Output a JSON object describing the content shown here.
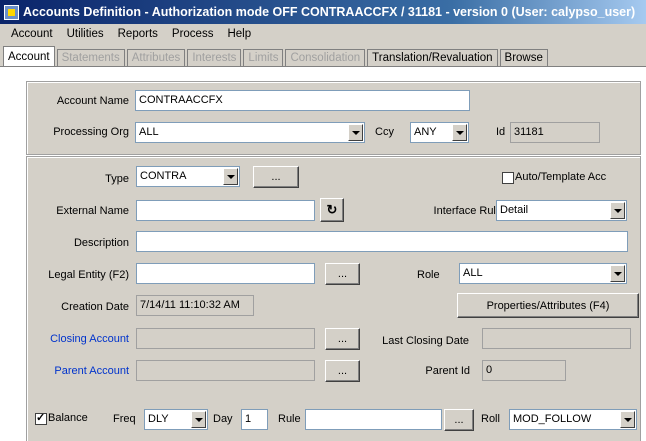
{
  "window": {
    "title": "Accounts Definition - Authorization mode OFF CONTRAACCFX / 31181 - version 0 (User: calypso_user)"
  },
  "menu": [
    "Account",
    "Utilities",
    "Reports",
    "Process",
    "Help"
  ],
  "tabs": [
    {
      "label": "Account",
      "state": "active"
    },
    {
      "label": "Statements",
      "state": "disabled"
    },
    {
      "label": "Attributes",
      "state": "disabled"
    },
    {
      "label": "Interests",
      "state": "disabled"
    },
    {
      "label": "Limits",
      "state": "disabled"
    },
    {
      "label": "Consolidation",
      "state": "disabled"
    },
    {
      "label": "Translation/Revaluation",
      "state": "enabled"
    },
    {
      "label": "Browse",
      "state": "enabled"
    }
  ],
  "header": {
    "account_name_label": "Account Name",
    "account_name_value": "CONTRAACCFX",
    "processing_org_label": "Processing Org",
    "processing_org_value": "ALL",
    "ccy_label": "Ccy",
    "ccy_value": "ANY",
    "id_label": "Id",
    "id_value": "31181"
  },
  "details": {
    "type_label": "Type",
    "type_value": "CONTRA",
    "ellipsis": "...",
    "auto_template_label": "Auto/Template Acc",
    "external_name_label": "External Name",
    "external_name_value": "",
    "interface_rule_label": "Interface Rule",
    "interface_rule_value": "Detail",
    "description_label": "Description",
    "description_value": "",
    "legal_entity_label": "Legal Entity (F2)",
    "legal_entity_value": "",
    "role_label": "Role",
    "role_value": "ALL",
    "creation_date_label": "Creation Date",
    "creation_date_value": "7/14/11 11:10:32 AM",
    "properties_button": "Properties/Attributes (F4)",
    "closing_account_label": "Closing Account",
    "closing_account_value": "",
    "last_closing_date_label": "Last Closing Date",
    "last_closing_date_value": "",
    "parent_account_label": "Parent Account",
    "parent_account_value": "",
    "parent_id_label": "Parent Id",
    "parent_id_value": "0"
  },
  "bottom": {
    "balance_label": "Balance",
    "freq_label": "Freq",
    "freq_value": "DLY",
    "day_label": "Day",
    "day_value": "1",
    "rule_label": "Rule",
    "rule_value": "",
    "roll_label": "Roll",
    "roll_value": "MOD_FOLLOW"
  },
  "colors": {
    "link": "#0033cc",
    "title_start": "#0a246a",
    "title_end": "#a6caf0"
  }
}
